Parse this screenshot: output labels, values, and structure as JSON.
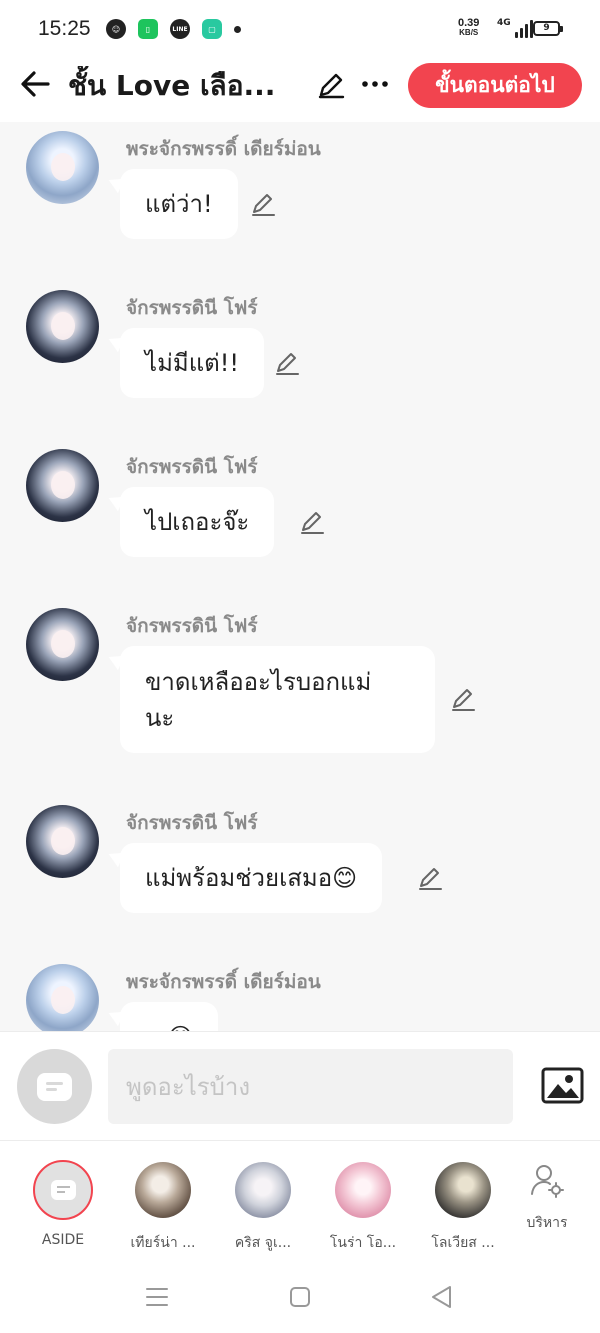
{
  "status_bar": {
    "time": "15:25",
    "net_speed": "0.39",
    "net_speed_unit": "KB/S",
    "network_type": "4G",
    "battery": "9",
    "notification_icons": [
      "ghost-icon",
      "green-app-icon",
      "line-app-icon",
      "chat-app-icon",
      "dot-icon"
    ]
  },
  "header": {
    "title": "ชั้น Love เลือ...",
    "next_button": "ขั้นตอนต่อไป"
  },
  "messages": [
    {
      "sender": "พระจักรพรรดิ์ เดียร์ม่อน",
      "text": "แต่ว่า!",
      "avatar": "style-a"
    },
    {
      "sender": "จักรพรรดินี โฟร์",
      "text": "ไม่มีแต่!!",
      "avatar": "style-b"
    },
    {
      "sender": "จักรพรรดินี โฟร์",
      "text": "ไปเถอะจ๊ะ",
      "avatar": "style-b"
    },
    {
      "sender": "จักรพรรดินี โฟร์",
      "text": "ขาดเหลืออะไรบอกแม่นะ",
      "avatar": "style-b"
    },
    {
      "sender": "จักรพรรดินี โฟร์",
      "text": "แม่พร้อมช่วยเสมอ😊",
      "avatar": "style-b"
    },
    {
      "sender": "พระจักรพรรดิ์ เดียร์ม่อน",
      "text": "...😊",
      "avatar": "style-a"
    }
  ],
  "composer": {
    "placeholder": "พูดอะไรบ้าง"
  },
  "characters": [
    {
      "label": "ASIDE"
    },
    {
      "label": "เทียร์น่า ..."
    },
    {
      "label": "คริส จูเ..."
    },
    {
      "label": "โนร่า โอ..."
    },
    {
      "label": "โลเวียส ..."
    },
    {
      "label": "บริหาร"
    }
  ],
  "colors": {
    "accent": "#f2444f",
    "chat_background": "#f7f7f7",
    "sender_text": "#8a8a8a"
  }
}
